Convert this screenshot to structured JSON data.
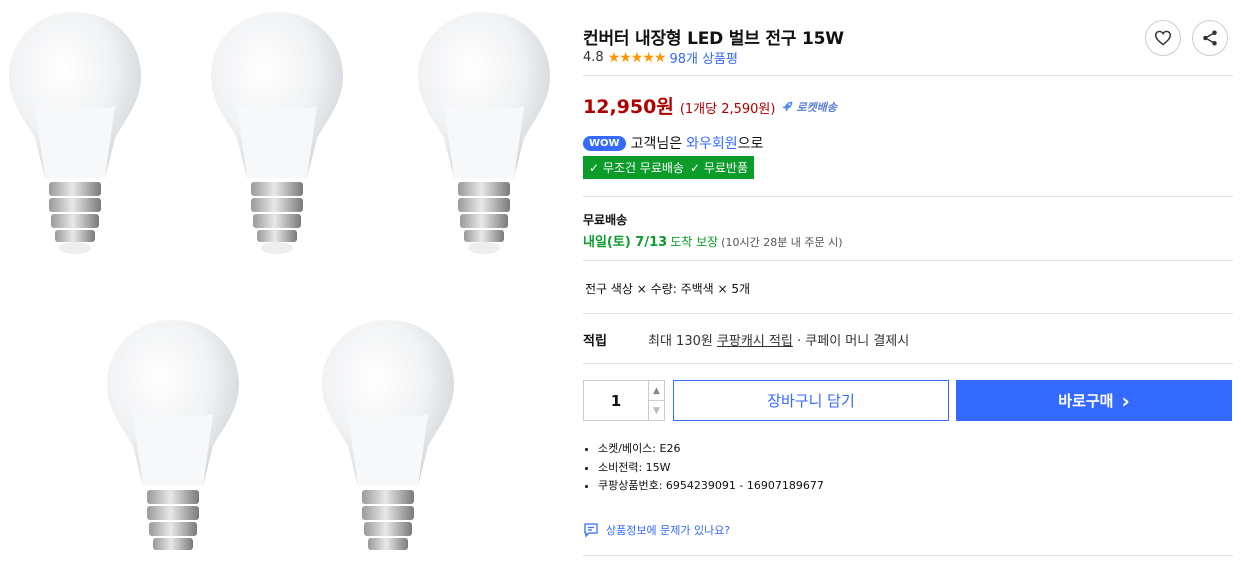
{
  "product": {
    "title": "컨버터 내장형 LED 벌브 전구 15W",
    "rating_score": "4.8",
    "stars": "★★★★★",
    "review_count": "98개 상품평",
    "price": "12,950원",
    "unit_price": "(1개당 2,590원)",
    "rocket_label": "로켓배송"
  },
  "actions": {
    "wishlist": "heart-icon",
    "share": "share-icon"
  },
  "wow": {
    "badge": "WOW",
    "prefix": "고객님은",
    "member": "와우회원",
    "suffix": "으로",
    "benefit_1": "✓ 무조건 무료배송",
    "benefit_2": "✓ 무료반품"
  },
  "shipping": {
    "label": "무료배송",
    "date": "내일(토) 7/13",
    "guarantee": "도착 보장",
    "cutoff": "(10시간 28분 내 주문 시)"
  },
  "option": {
    "text": "전구 색상 × 수량: 주백색 × 5개"
  },
  "points": {
    "label": "적립",
    "prefix": "최대 130원",
    "link": "쿠팡캐시 적립",
    "suffix": "· 쿠페이 머니 결제시"
  },
  "purchase": {
    "quantity": "1",
    "cart_label": "장바구니 담기",
    "buy_label": "바로구매",
    "buy_chevron": "›"
  },
  "specs": [
    "소켓/베이스: E26",
    "소비전력: 15W",
    "쿠팡상품번호: 6954239091 - 16907189677"
  ],
  "report_link": "상품정보에 문제가 있나요?",
  "colors": {
    "accent": "#346aff",
    "price": "#ae0000",
    "green": "#0b9c2a",
    "star": "#ff9600"
  }
}
